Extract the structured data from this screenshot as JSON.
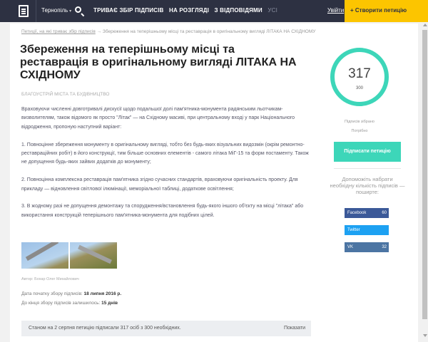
{
  "header": {
    "logo_icon": "document-logo-icon",
    "city": "Тернопіль",
    "nav": [
      {
        "label": "ТРИВАЄ ЗБІР ПІДПИСІВ"
      },
      {
        "label": "НА РОЗГЛЯДІ"
      },
      {
        "label": "З ВІДПОВІДЯМИ"
      },
      {
        "label": "УСІ"
      }
    ],
    "login": "Увійти",
    "create_petition": "+ Створити петицію"
  },
  "breadcrumb": {
    "parent": "Петиції, на які триває збір підписів",
    "current": "→ Збереження на теперішньому місці та реставрація в оригінальному вигляді ЛІТАКА НА СХІДНОМУ"
  },
  "petition": {
    "title": "Збереження на теперішньому місці та реставрація в оригінальному вигляді ЛІТАКА НА СХІДНОМУ",
    "category": "БЛАГОУСТРІЙ МІСТА ТА БУДІВНИЦТВО",
    "paragraphs": [
      "Враховуючи численні довготривалі дискусії щодо подальшої долі пам'ятника-монумента радянським льотчикам-визволителям, також відомого як просто \"Літак\" — на Східному масиві, при центральному вході у парк Національного відродження, пропоную наступний варіант:",
      "1. Повноцінне збереження монументу в оригінальному вигляді, тобто без будь-яких візуальних видозмін (окрім ремонтно-реставраційних робіт) в його конструкції, тим більше основних елементів - самого літака МіГ-15 та форм постаменту. Також не допущення будь-яких зайвих додатків до монументу;",
      "2. Повноцінна комплексна реставрація пам'ятника згідно сучасних стандартів, враховуючи оригінальність проекту. Для прикладу — відновлення світлової ілюмінації, меморіальної таблиці, додаткове освітлення;",
      "3. В жодному разі не допущення демонтажу та спорудження/встановлення будь-якого іншого об'єкту на місці \"літака\" або використання конструкцій теперішнього пам'ятника-монумента для подібних цілей."
    ],
    "author": "Автор: Бохар Олег Михайлович",
    "start_label": "Дата початку збору підписів:",
    "start_date": "18 липня 2016 р.",
    "remaining_label": "До кінця збору підписів залишилось:",
    "remaining_value": "15 днів",
    "status_text": "Станом на 2 серпня петицію підписали 317 осіб з 300 необхідних.",
    "show_label": "Показати"
  },
  "sidebar": {
    "signatures": "317",
    "needed": "300",
    "collected_label": "Підписів зібрано",
    "needed_label": "Потрібно",
    "sign_button": "Підписати петицію",
    "help_text": "Допоможіть набрати необхідну кількість підписів — поширте:",
    "share": [
      {
        "network": "Facebook",
        "count": "60"
      },
      {
        "network": "Twitter",
        "count": ""
      },
      {
        "network": "VK",
        "count": "32"
      }
    ]
  },
  "colors": {
    "header_bg": "#2d3142",
    "accent_yellow": "#fcc500",
    "accent_teal": "#3dd6b9",
    "facebook": "#3b5998",
    "twitter": "#1da1f2",
    "vk": "#4c75a3"
  }
}
